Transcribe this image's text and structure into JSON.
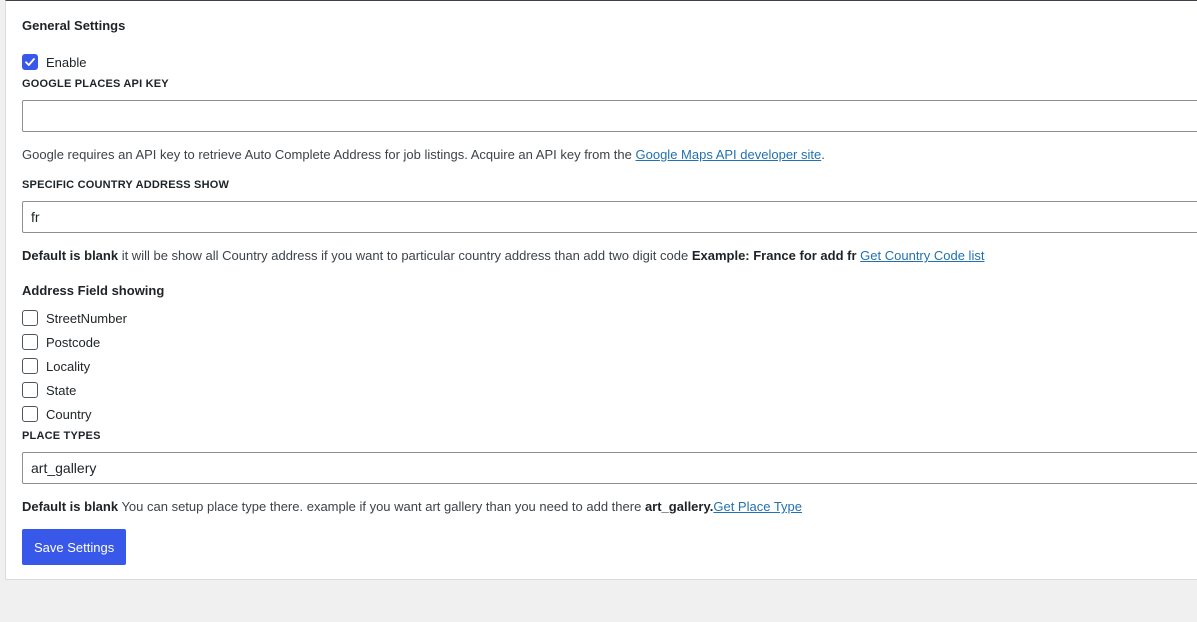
{
  "section_title": "General Settings",
  "enable": {
    "label": "Enable",
    "checked": true
  },
  "api_key": {
    "label": "GOOGLE PLACES API KEY",
    "value": "",
    "help_text": "Google requires an API key to retrieve Auto Complete Address for job listings. Acquire an API key from the ",
    "help_link": "Google Maps API developer site",
    "help_after": "."
  },
  "country": {
    "label": "SPECIFIC COUNTRY ADDRESS SHOW",
    "value": "fr",
    "help_bold1": "Default is blank",
    "help_text": " it will be show all Country address if you want to particular country address than add two digit code ",
    "help_bold2": "Example: France for add fr",
    "help_link": "Get Country Code list"
  },
  "address_fields": {
    "title": "Address Field showing",
    "items": [
      {
        "label": "StreetNumber",
        "checked": false
      },
      {
        "label": "Postcode",
        "checked": false
      },
      {
        "label": "Locality",
        "checked": false
      },
      {
        "label": "State",
        "checked": false
      },
      {
        "label": "Country",
        "checked": false
      }
    ]
  },
  "place_types": {
    "label": "PLACE TYPES",
    "value": "art_gallery",
    "help_bold1": "Default is blank",
    "help_text": " You can setup place type there. example if you want art gallery than you need to add there ",
    "help_bold2": "art_gallery.",
    "help_link": "Get Place Type"
  },
  "save_button": "Save Settings",
  "colors": {
    "accent": "#3858e9",
    "link": "#2271b1"
  }
}
